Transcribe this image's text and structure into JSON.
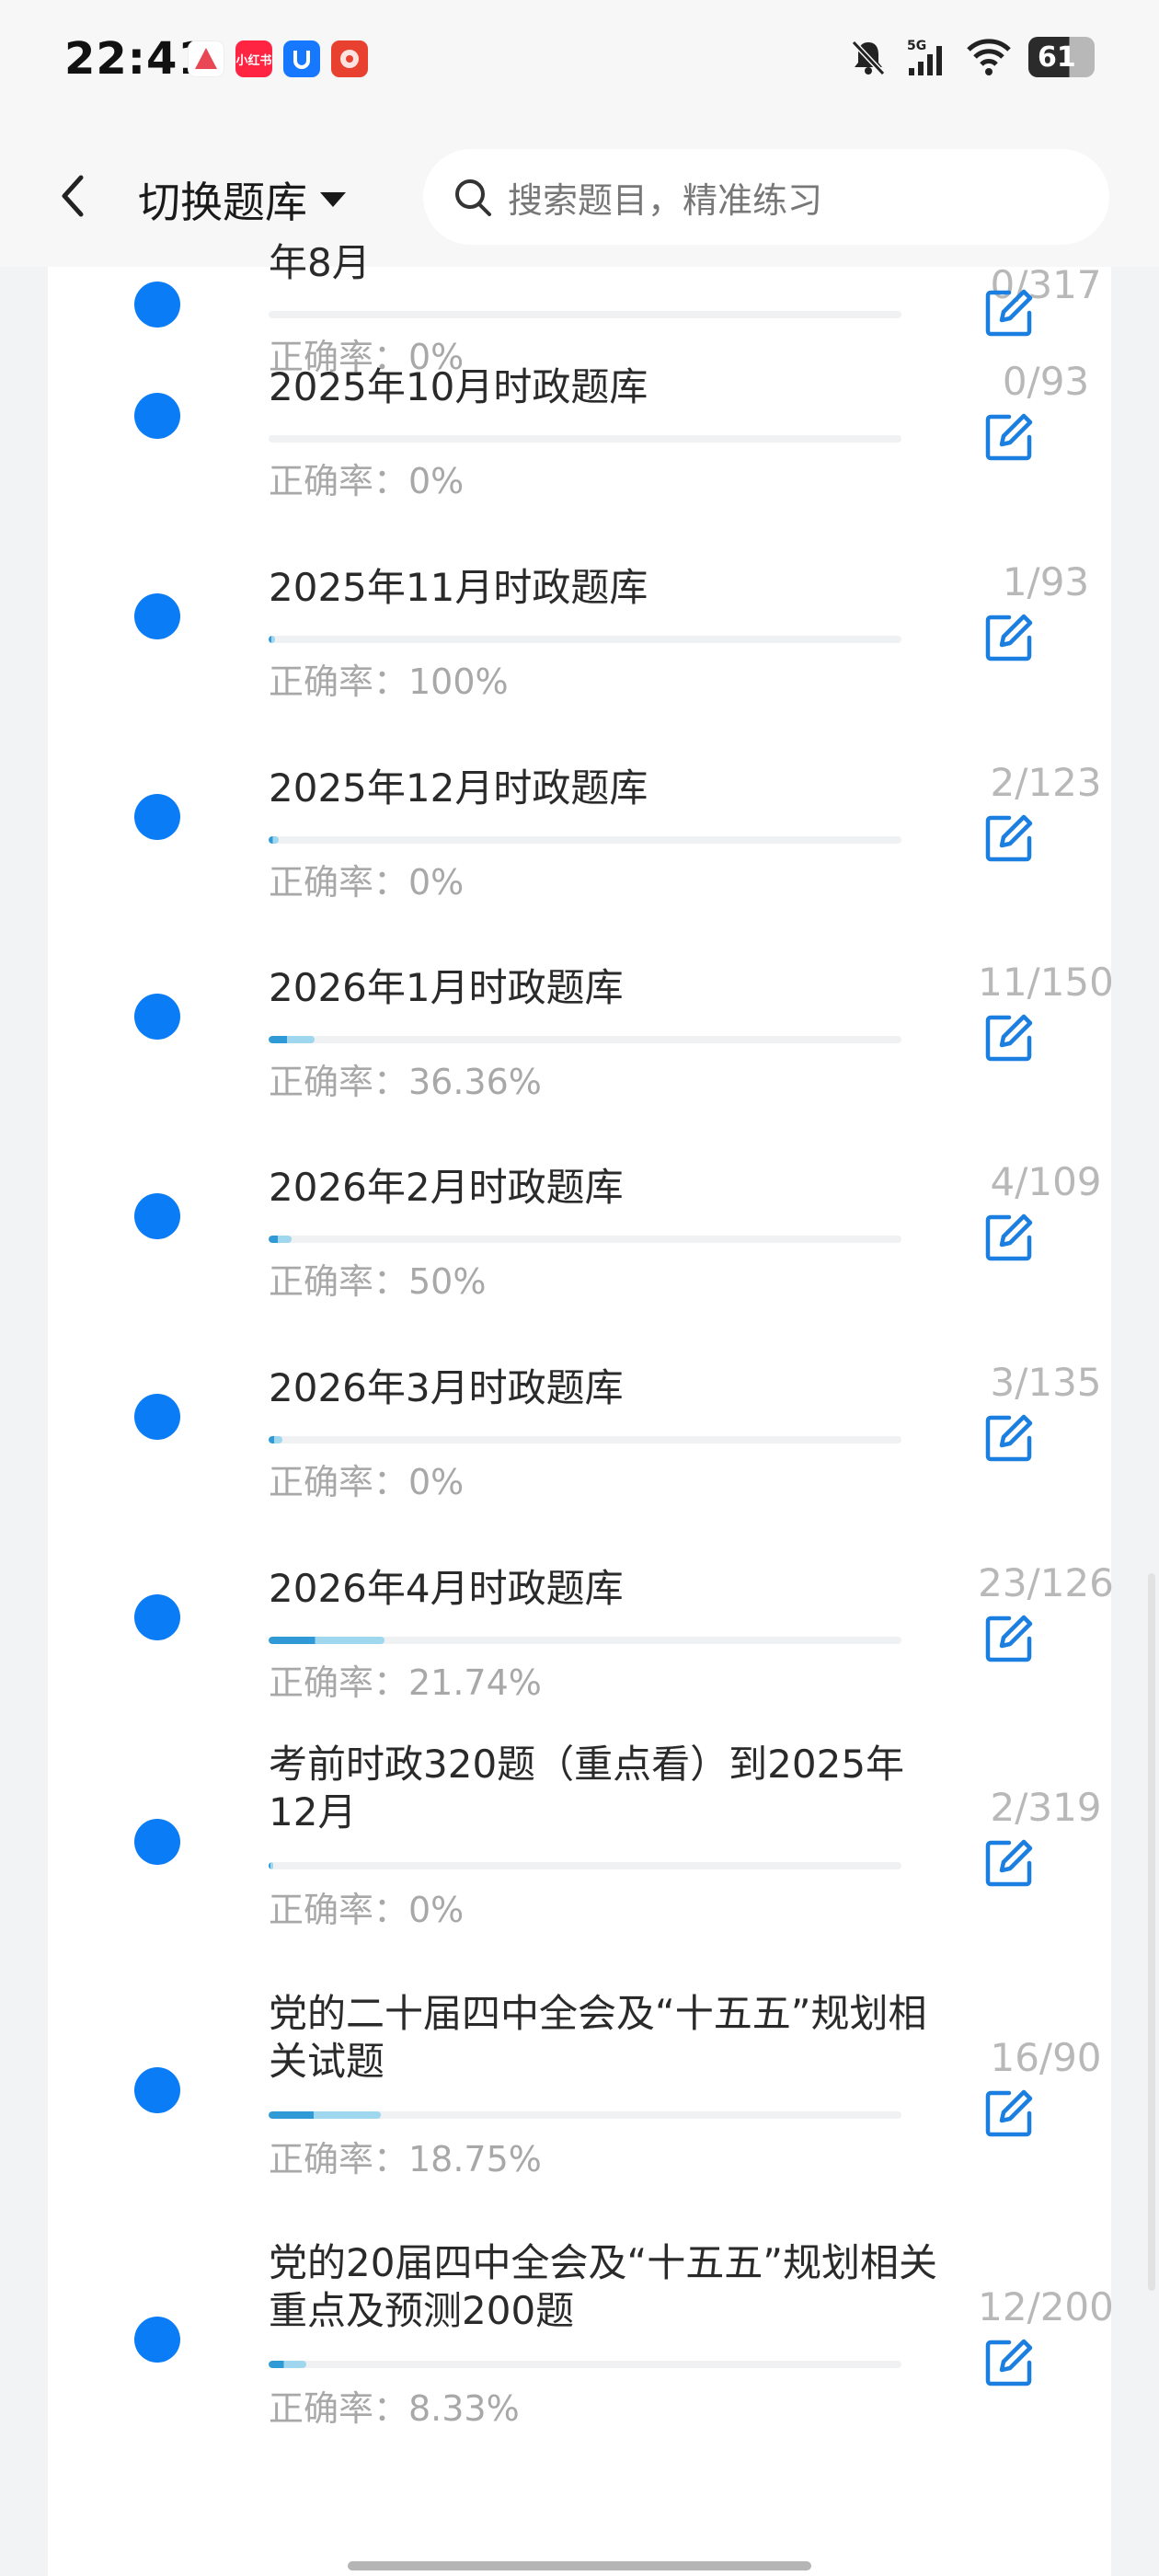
{
  "status": {
    "time": "22:41",
    "battery": "61",
    "network": "5G"
  },
  "status_apps": [
    {
      "name": "app-icon-1",
      "label": "",
      "color": "#ffffff"
    },
    {
      "name": "xiaohongshu-app-icon",
      "label": "小红书",
      "color": "#ff2442"
    },
    {
      "name": "app-icon-3",
      "label": "",
      "color": "#1677ff"
    },
    {
      "name": "app-icon-4",
      "label": "",
      "color": "#e8412f"
    }
  ],
  "header": {
    "switch_label": "切换题库",
    "search_placeholder": "搜索题目，精准练习"
  },
  "colors": {
    "accent": "#0a7cf5",
    "progress": "#2f9ad6",
    "progress_light": "#9fd7ef",
    "muted": "#a8a8a8"
  },
  "items": [
    {
      "title": "年8月",
      "count": "0/317",
      "accuracy": "正确率：0%",
      "progress": 0
    },
    {
      "title": "2025年10月时政题库",
      "count": "0/93",
      "accuracy": "正确率：0%",
      "progress": 0
    },
    {
      "title": "2025年11月时政题库",
      "count": "1/93",
      "accuracy": "正确率：100%",
      "progress": 0.0108
    },
    {
      "title": "2025年12月时政题库",
      "count": "2/123",
      "accuracy": "正确率：0%",
      "progress": 0.0163
    },
    {
      "title": "2026年1月时政题库",
      "count": "11/150",
      "accuracy": "正确率：36.36%",
      "progress": 0.0733
    },
    {
      "title": "2026年2月时政题库",
      "count": "4/109",
      "accuracy": "正确率：50%",
      "progress": 0.0367
    },
    {
      "title": "2026年3月时政题库",
      "count": "3/135",
      "accuracy": "正确率：0%",
      "progress": 0.0222
    },
    {
      "title": "2026年4月时政题库",
      "count": "23/126",
      "accuracy": "正确率：21.74%",
      "progress": 0.1825
    },
    {
      "title": "考前时政320题（重点看）到2025年12月",
      "count": "2/319",
      "accuracy": "正确率：0%",
      "progress": 0.0063
    },
    {
      "title": "党的二十届四中全会及“十五五”规划相关试题",
      "count": "16/90",
      "accuracy": "正确率：18.75%",
      "progress": 0.1778
    },
    {
      "title": "党的20届四中全会及“十五五”规划相关重点及预测200题",
      "count": "12/200",
      "accuracy": "正确率：8.33%",
      "progress": 0.06
    }
  ]
}
